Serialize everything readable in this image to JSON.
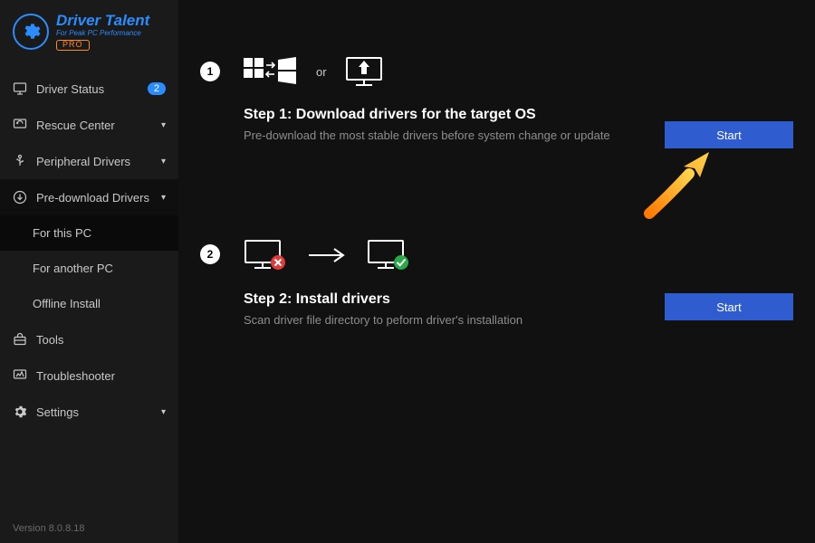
{
  "brand": {
    "name": "Driver Talent",
    "tagline": "For Peak PC Performance",
    "pro": "PRO"
  },
  "titlebar": {},
  "sidebar": {
    "items": [
      {
        "label": "Driver Status",
        "badge": "2"
      },
      {
        "label": "Rescue Center"
      },
      {
        "label": "Peripheral Drivers"
      },
      {
        "label": "Pre-download Drivers"
      },
      {
        "label": "Tools"
      },
      {
        "label": "Troubleshooter"
      },
      {
        "label": "Settings"
      }
    ],
    "sub_predownload": [
      {
        "label": "For this PC"
      },
      {
        "label": "For another PC"
      },
      {
        "label": "Offline Install"
      }
    ]
  },
  "content": {
    "or": "or",
    "step1": {
      "title": "Step 1: Download drivers for the target OS",
      "desc": "Pre-download the most stable drivers before system change or update",
      "button": "Start"
    },
    "step2": {
      "title": "Step 2: Install drivers",
      "desc": "Scan driver file directory to peform driver's installation",
      "button": "Start"
    }
  },
  "version": "Version 8.0.8.18"
}
